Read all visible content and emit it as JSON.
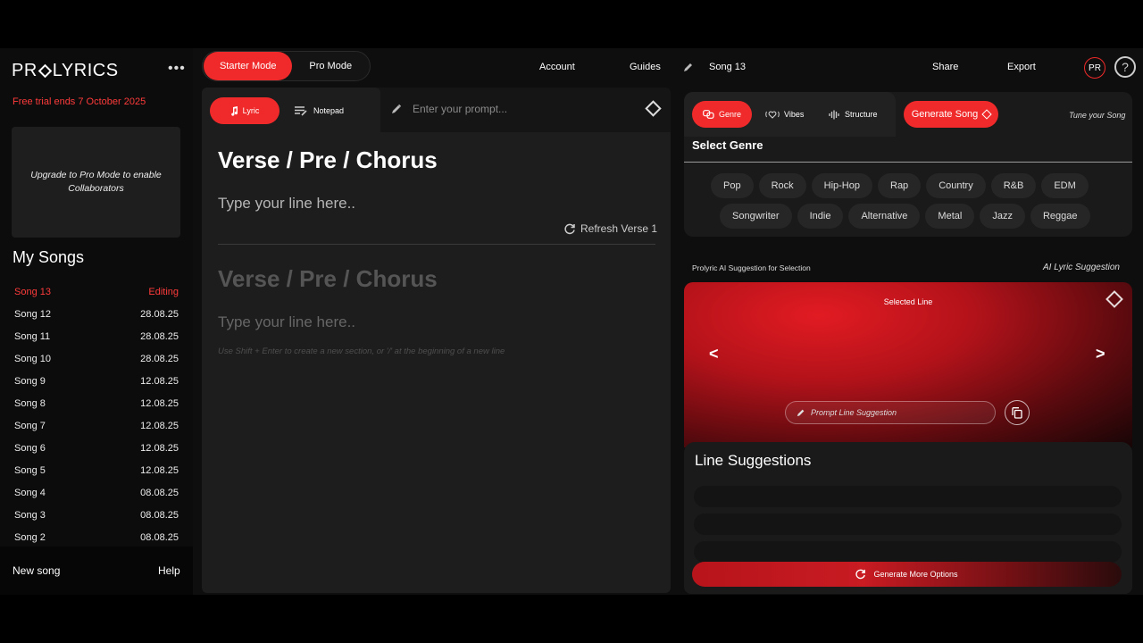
{
  "brand": {
    "logo_left": "PR",
    "logo_right": "LYRICS"
  },
  "sidebar": {
    "trial": "Free trial ends 7 October 2025",
    "upgrade": "Upgrade to Pro Mode to enable Collaborators",
    "my_songs": "My Songs",
    "songs": [
      {
        "name": "Song 13",
        "date": "Editing"
      },
      {
        "name": "Song 12",
        "date": "28.08.25"
      },
      {
        "name": "Song 11",
        "date": "28.08.25"
      },
      {
        "name": "Song 10",
        "date": "28.08.25"
      },
      {
        "name": "Song 9",
        "date": "12.08.25"
      },
      {
        "name": "Song 8",
        "date": "12.08.25"
      },
      {
        "name": "Song 7",
        "date": "12.08.25"
      },
      {
        "name": "Song 6",
        "date": "12.08.25"
      },
      {
        "name": "Song 5",
        "date": "12.08.25"
      },
      {
        "name": "Song 4",
        "date": "08.08.25"
      },
      {
        "name": "Song 3",
        "date": "08.08.25"
      },
      {
        "name": "Song 2",
        "date": "08.08.25"
      }
    ],
    "new_song": "New song",
    "help": "Help"
  },
  "topbar": {
    "starter_mode": "Starter Mode",
    "pro_mode": "Pro Mode",
    "account": "Account",
    "guides": "Guides",
    "song_name": "Song 13",
    "share": "Share",
    "export": "Export",
    "avatar": "PR",
    "help_icon": "?"
  },
  "editor": {
    "tab_lyric": "Lyric",
    "tab_notepad": "Notepad",
    "prompt_placeholder": "Enter your prompt...",
    "section1_title": "Verse / Pre / Chorus",
    "section1_line": "Type your line here..",
    "refresh": "Refresh Verse 1",
    "section2_title": "Verse / Pre / Chorus",
    "section2_line": "Type your line here..",
    "hint": "Use Shift + Enter to create a new section, or '/' at the beginning of a new line"
  },
  "genre_panel": {
    "tab_genre": "Genre",
    "tab_vibes": "Vibes",
    "tab_structure": "Structure",
    "generate_song": "Generate Song",
    "tune": "Tune your Song",
    "select_genre": "Select Genre",
    "genres": [
      "Pop",
      "Rock",
      "Hip-Hop",
      "Rap",
      "Country",
      "R&B",
      "EDM",
      "Songwriter",
      "Indie",
      "Alternative",
      "Metal",
      "Jazz",
      "Reggae"
    ]
  },
  "ai": {
    "label": "Prolyric AI Suggestion for Selection",
    "right_label": "AI Lyric Suggestion",
    "selected_line": "Selected Line",
    "prev": "<",
    "next": ">",
    "prompt_line": "Prompt Line Suggestion"
  },
  "line_suggestions": {
    "title": "Line Suggestions",
    "generate_more": "Generate More Options"
  },
  "colors": {
    "accent": "#f02a2a",
    "trial": "#ff3b3b"
  }
}
